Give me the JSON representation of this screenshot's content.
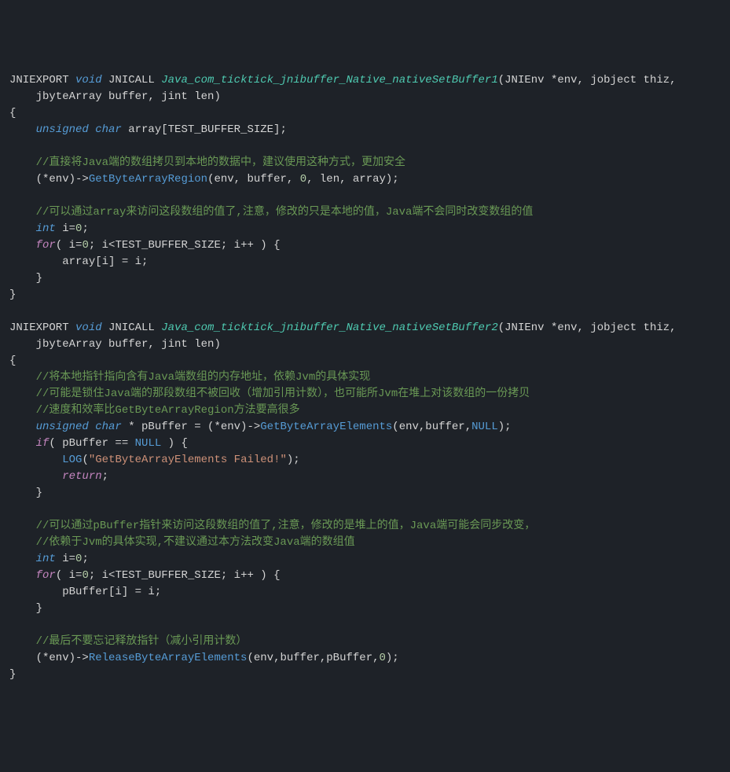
{
  "lines": [
    {
      "segments": [
        {
          "cls": "macro",
          "t": "JNIEXPORT "
        },
        {
          "cls": "type",
          "t": "void"
        },
        {
          "cls": "macro",
          "t": " JNICALL "
        },
        {
          "cls": "funcdef",
          "t": "Java_com_ticktick_jnibuffer_Native_nativeSetBuffer1"
        },
        {
          "cls": "paren",
          "t": "(JNIEnv *env, jobject thiz,"
        }
      ]
    },
    {
      "segments": [
        {
          "cls": "ident",
          "t": "    jbyteArray buffer, jint len)"
        }
      ]
    },
    {
      "segments": [
        {
          "cls": "paren",
          "t": "{"
        }
      ]
    },
    {
      "segments": [
        {
          "cls": "ident",
          "t": "    "
        },
        {
          "cls": "type",
          "t": "unsigned char"
        },
        {
          "cls": "ident",
          "t": " array[TEST_BUFFER_SIZE];"
        }
      ]
    },
    {
      "segments": [
        {
          "cls": "ident",
          "t": ""
        }
      ]
    },
    {
      "segments": [
        {
          "cls": "ident",
          "t": "    "
        },
        {
          "cls": "comment",
          "t": "//直接将Java端的数组拷贝到本地的数据中，建议使用这种方式，更加安全"
        }
      ]
    },
    {
      "segments": [
        {
          "cls": "ident",
          "t": "    (*env)->"
        },
        {
          "cls": "call",
          "t": "GetByteArrayRegion"
        },
        {
          "cls": "ident",
          "t": "(env, buffer, "
        },
        {
          "cls": "num",
          "t": "0"
        },
        {
          "cls": "ident",
          "t": ", len, array);"
        }
      ]
    },
    {
      "segments": [
        {
          "cls": "ident",
          "t": ""
        }
      ]
    },
    {
      "segments": [
        {
          "cls": "ident",
          "t": "    "
        },
        {
          "cls": "comment",
          "t": "//可以通过array来访问这段数组的值了,注意，修改的只是本地的值，Java端不会同时改变数组的值"
        }
      ]
    },
    {
      "segments": [
        {
          "cls": "ident",
          "t": "    "
        },
        {
          "cls": "type",
          "t": "int"
        },
        {
          "cls": "ident",
          "t": " i="
        },
        {
          "cls": "num",
          "t": "0"
        },
        {
          "cls": "ident",
          "t": ";"
        }
      ]
    },
    {
      "segments": [
        {
          "cls": "ident",
          "t": "    "
        },
        {
          "cls": "keyword",
          "t": "for"
        },
        {
          "cls": "ident",
          "t": "( i="
        },
        {
          "cls": "num",
          "t": "0"
        },
        {
          "cls": "ident",
          "t": "; i<TEST_BUFFER_SIZE; i++ ) {"
        }
      ]
    },
    {
      "segments": [
        {
          "cls": "ident",
          "t": "        array[i] = i;"
        }
      ]
    },
    {
      "segments": [
        {
          "cls": "ident",
          "t": "    }"
        }
      ]
    },
    {
      "segments": [
        {
          "cls": "paren",
          "t": "}"
        }
      ]
    },
    {
      "segments": [
        {
          "cls": "ident",
          "t": ""
        }
      ]
    },
    {
      "segments": [
        {
          "cls": "macro",
          "t": "JNIEXPORT "
        },
        {
          "cls": "type",
          "t": "void"
        },
        {
          "cls": "macro",
          "t": " JNICALL "
        },
        {
          "cls": "funcdef",
          "t": "Java_com_ticktick_jnibuffer_Native_nativeSetBuffer2"
        },
        {
          "cls": "paren",
          "t": "(JNIEnv *env, jobject thiz,"
        }
      ]
    },
    {
      "segments": [
        {
          "cls": "ident",
          "t": "    jbyteArray buffer, jint len)"
        }
      ]
    },
    {
      "segments": [
        {
          "cls": "paren",
          "t": "{"
        }
      ]
    },
    {
      "segments": [
        {
          "cls": "ident",
          "t": "    "
        },
        {
          "cls": "comment",
          "t": "//将本地指针指向含有Java端数组的内存地址，依赖Jvm的具体实现"
        }
      ]
    },
    {
      "segments": [
        {
          "cls": "ident",
          "t": "    "
        },
        {
          "cls": "comment",
          "t": "//可能是锁住Java端的那段数组不被回收（增加引用计数），也可能所Jvm在堆上对该数组的一份拷贝"
        }
      ]
    },
    {
      "segments": [
        {
          "cls": "ident",
          "t": "    "
        },
        {
          "cls": "comment",
          "t": "//速度和效率比GetByteArrayRegion方法要高很多"
        }
      ]
    },
    {
      "segments": [
        {
          "cls": "ident",
          "t": "    "
        },
        {
          "cls": "type",
          "t": "unsigned char"
        },
        {
          "cls": "ident",
          "t": " * pBuffer = (*env)->"
        },
        {
          "cls": "call",
          "t": "GetByteArrayElements"
        },
        {
          "cls": "ident",
          "t": "(env,buffer,"
        },
        {
          "cls": "null",
          "t": "NULL"
        },
        {
          "cls": "ident",
          "t": ");"
        }
      ]
    },
    {
      "segments": [
        {
          "cls": "ident",
          "t": "    "
        },
        {
          "cls": "keyword",
          "t": "if"
        },
        {
          "cls": "ident",
          "t": "( pBuffer == "
        },
        {
          "cls": "null",
          "t": "NULL"
        },
        {
          "cls": "ident",
          "t": " ) {"
        }
      ]
    },
    {
      "segments": [
        {
          "cls": "ident",
          "t": "        "
        },
        {
          "cls": "call",
          "t": "LOG"
        },
        {
          "cls": "ident",
          "t": "("
        },
        {
          "cls": "str",
          "t": "\"GetByteArrayElements Failed!\""
        },
        {
          "cls": "ident",
          "t": ");"
        }
      ]
    },
    {
      "segments": [
        {
          "cls": "ident",
          "t": "        "
        },
        {
          "cls": "keyword",
          "t": "return"
        },
        {
          "cls": "ident",
          "t": ";"
        }
      ]
    },
    {
      "segments": [
        {
          "cls": "ident",
          "t": "    }"
        }
      ]
    },
    {
      "segments": [
        {
          "cls": "ident",
          "t": ""
        }
      ]
    },
    {
      "segments": [
        {
          "cls": "ident",
          "t": "    "
        },
        {
          "cls": "comment",
          "t": "//可以通过pBuffer指针来访问这段数组的值了,注意，修改的是堆上的值，Java端可能会同步改变，"
        }
      ]
    },
    {
      "segments": [
        {
          "cls": "ident",
          "t": "    "
        },
        {
          "cls": "comment",
          "t": "//依赖于Jvm的具体实现,不建议通过本方法改变Java端的数组值"
        }
      ]
    },
    {
      "segments": [
        {
          "cls": "ident",
          "t": "    "
        },
        {
          "cls": "type",
          "t": "int"
        },
        {
          "cls": "ident",
          "t": " i="
        },
        {
          "cls": "num",
          "t": "0"
        },
        {
          "cls": "ident",
          "t": ";"
        }
      ]
    },
    {
      "segments": [
        {
          "cls": "ident",
          "t": "    "
        },
        {
          "cls": "keyword",
          "t": "for"
        },
        {
          "cls": "ident",
          "t": "( i="
        },
        {
          "cls": "num",
          "t": "0"
        },
        {
          "cls": "ident",
          "t": "; i<TEST_BUFFER_SIZE; i++ ) {"
        }
      ]
    },
    {
      "segments": [
        {
          "cls": "ident",
          "t": "        pBuffer[i] = i;"
        }
      ]
    },
    {
      "segments": [
        {
          "cls": "ident",
          "t": "    }"
        }
      ]
    },
    {
      "segments": [
        {
          "cls": "ident",
          "t": ""
        }
      ]
    },
    {
      "segments": [
        {
          "cls": "ident",
          "t": "    "
        },
        {
          "cls": "comment",
          "t": "//最后不要忘记释放指针（减小引用计数）"
        }
      ]
    },
    {
      "segments": [
        {
          "cls": "ident",
          "t": "    (*env)->"
        },
        {
          "cls": "call",
          "t": "ReleaseByteArrayElements"
        },
        {
          "cls": "ident",
          "t": "(env,buffer,pBuffer,"
        },
        {
          "cls": "num",
          "t": "0"
        },
        {
          "cls": "ident",
          "t": ");"
        }
      ]
    },
    {
      "segments": [
        {
          "cls": "paren",
          "t": "}"
        }
      ]
    }
  ]
}
